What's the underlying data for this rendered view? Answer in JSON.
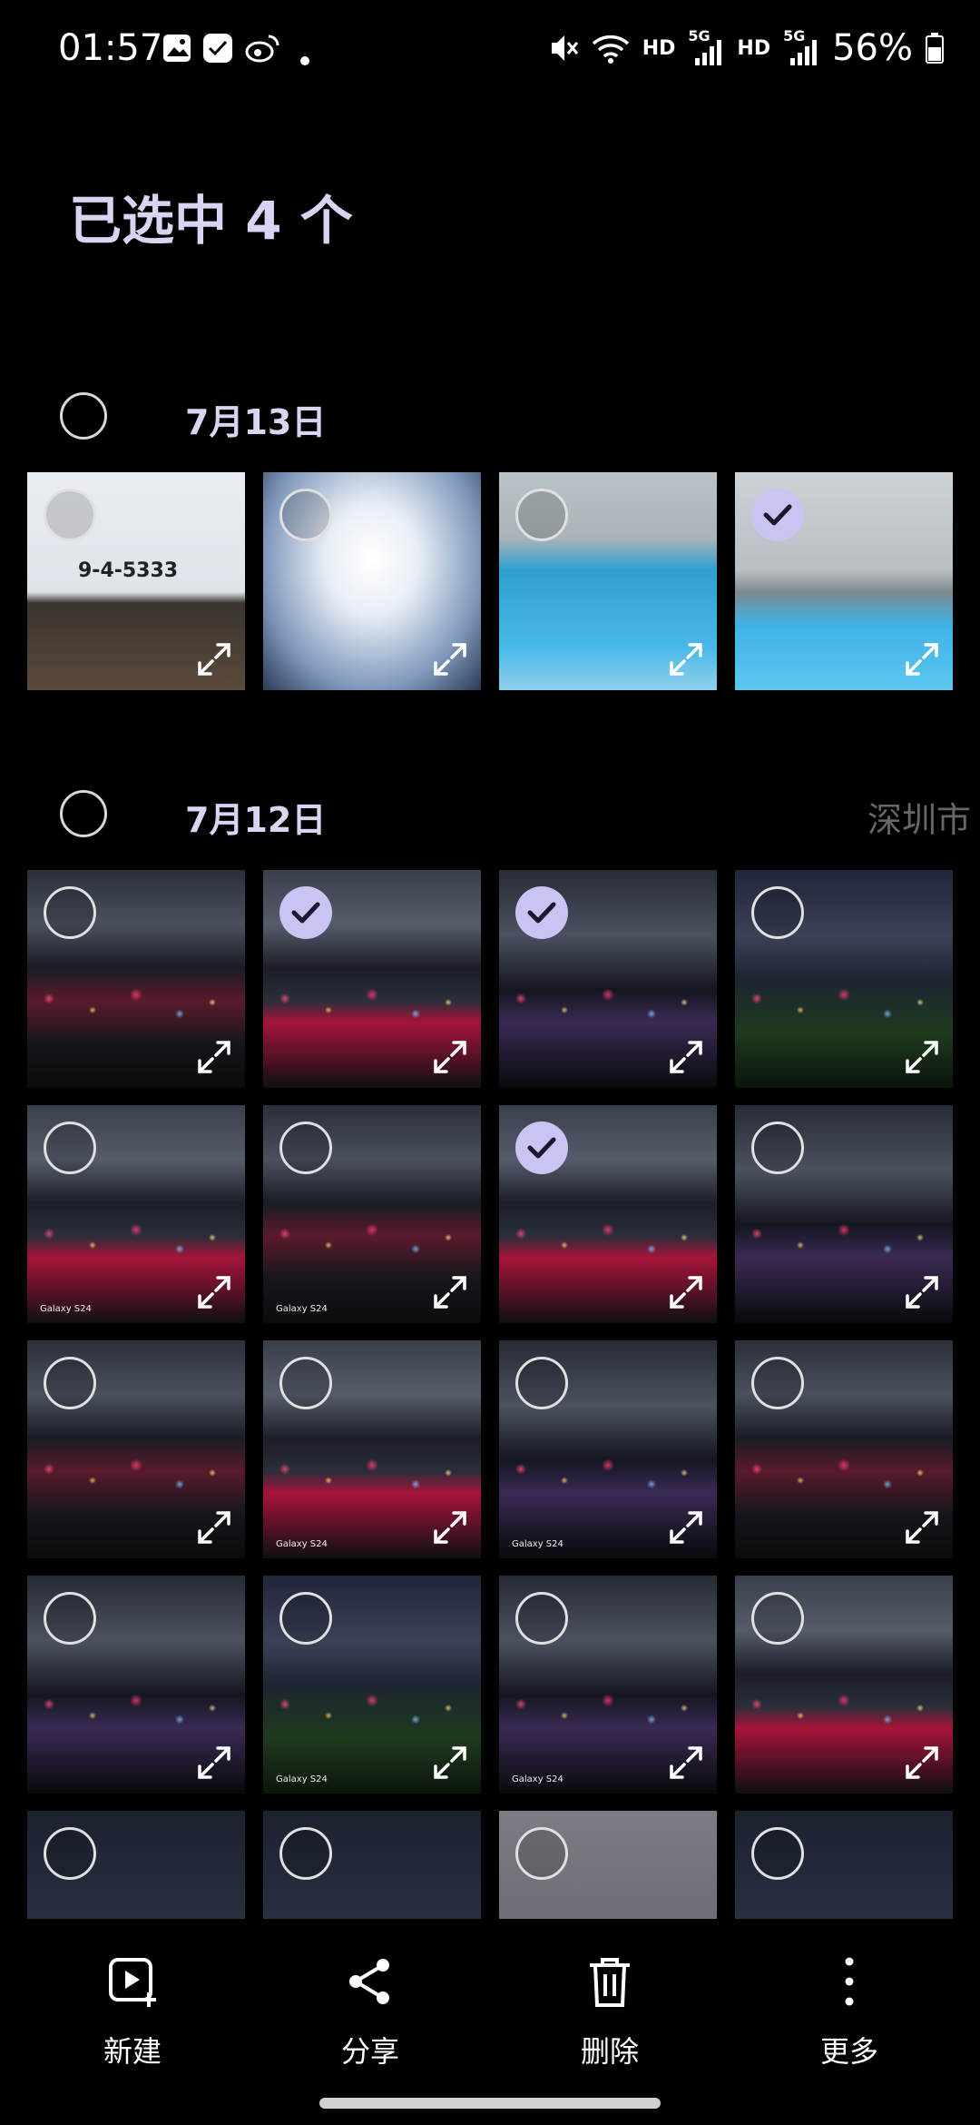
{
  "status_bar": {
    "time": "01:57",
    "net1": "HD",
    "net1_tag": "5G",
    "net2": "HD",
    "net2_tag": "5G",
    "battery": "56%"
  },
  "header": {
    "title": "已选中 4 个"
  },
  "sections": [
    {
      "date": "7月13日",
      "location": ""
    },
    {
      "date": "7月12日",
      "location": "深圳市"
    }
  ],
  "photos": {
    "jul13": [
      {
        "style": "p-doc",
        "selected": false,
        "text": "9-4-5333"
      },
      {
        "style": "p-cloud",
        "selected": false
      },
      {
        "style": "p-pool",
        "selected": false
      },
      {
        "style": "p-pool2",
        "selected": true
      }
    ],
    "jul12": [
      {
        "style": "p-night1",
        "selected": false,
        "watermark": ""
      },
      {
        "style": "p-night2",
        "selected": true,
        "watermark": ""
      },
      {
        "style": "p-night3",
        "selected": true,
        "watermark": ""
      },
      {
        "style": "p-night4",
        "selected": false,
        "watermark": ""
      },
      {
        "style": "p-night2",
        "selected": false,
        "watermark": "Galaxy S24"
      },
      {
        "style": "p-night1",
        "selected": false,
        "watermark": "Galaxy S24"
      },
      {
        "style": "p-night2",
        "selected": true,
        "watermark": ""
      },
      {
        "style": "p-night3",
        "selected": false,
        "watermark": ""
      },
      {
        "style": "p-night1",
        "selected": false,
        "watermark": ""
      },
      {
        "style": "p-night2",
        "selected": false,
        "watermark": "Galaxy S24"
      },
      {
        "style": "p-night3",
        "selected": false,
        "watermark": "Galaxy S24"
      },
      {
        "style": "p-night1",
        "selected": false,
        "watermark": ""
      },
      {
        "style": "p-night3",
        "selected": false,
        "watermark": ""
      },
      {
        "style": "p-night4",
        "selected": false,
        "watermark": "Galaxy S24"
      },
      {
        "style": "p-night3",
        "selected": false,
        "watermark": "Galaxy S24"
      },
      {
        "style": "p-night2",
        "selected": false,
        "watermark": ""
      },
      {
        "style": "p-dim",
        "selected": false,
        "watermark": ""
      },
      {
        "style": "p-dim",
        "selected": false,
        "watermark": ""
      },
      {
        "style": "p-gray",
        "selected": false,
        "watermark": ""
      },
      {
        "style": "p-dim",
        "selected": false,
        "watermark": ""
      }
    ]
  },
  "toolbar": {
    "new_label": "新建",
    "share_label": "分享",
    "delete_label": "删除",
    "more_label": "更多"
  },
  "colors": {
    "accent": "#c9c4f2",
    "title": "#d9d4f2",
    "background": "#000000"
  }
}
